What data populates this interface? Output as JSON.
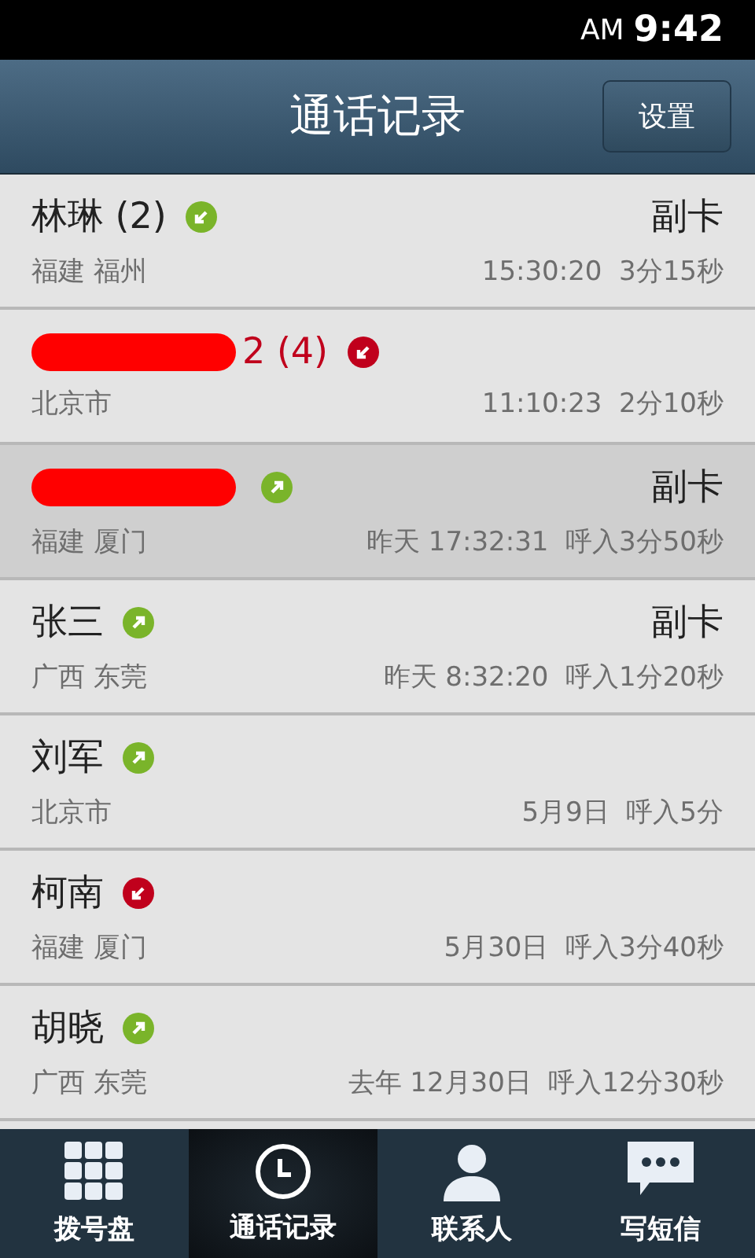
{
  "status_bar": {
    "ampm": "AM",
    "time": "9:42"
  },
  "header": {
    "title": "通话记录",
    "settings_button": "设置"
  },
  "calls": [
    {
      "name": "林琳 (2)",
      "redacted": false,
      "kind": "in",
      "sim": "副卡",
      "location": "福建 福州",
      "time": "15:30:20",
      "duration": "3分15秒",
      "selected": false
    },
    {
      "name": "2 (4)",
      "unread": true,
      "redacted": true,
      "kind": "missed",
      "location": "北京市",
      "time": "11:10:23",
      "duration": "2分10秒",
      "selected": false
    },
    {
      "redacted": true,
      "kind": "out",
      "sim": "副卡",
      "location": "福建 厦门",
      "time": "昨天 17:32:31",
      "duration": "呼入3分50秒",
      "selected": true
    },
    {
      "name": "张三",
      "redacted": false,
      "kind": "out",
      "sim": "副卡",
      "location": "广西 东莞",
      "time": "昨天 8:32:20",
      "duration": "呼入1分20秒",
      "selected": false
    },
    {
      "name": "刘军",
      "redacted": false,
      "kind": "out",
      "location": "北京市",
      "time": "5月9日",
      "duration": "呼入5分",
      "selected": false
    },
    {
      "name": "柯南",
      "redacted": false,
      "kind": "missed",
      "location": "福建 厦门",
      "time": "5月30日",
      "duration": "呼入3分40秒",
      "selected": false
    },
    {
      "name": "胡晓",
      "redacted": false,
      "kind": "out",
      "location": "广西 东莞",
      "time": "去年 12月30日",
      "duration": "呼入12分30秒",
      "selected": false
    }
  ],
  "tabs": [
    {
      "label": "拨号盘",
      "kind": "dialpad",
      "selected": false
    },
    {
      "label": "通话记录",
      "kind": "clock",
      "selected": true
    },
    {
      "label": "联系人",
      "kind": "person",
      "selected": false
    },
    {
      "label": "写短信",
      "kind": "message",
      "selected": false
    }
  ]
}
